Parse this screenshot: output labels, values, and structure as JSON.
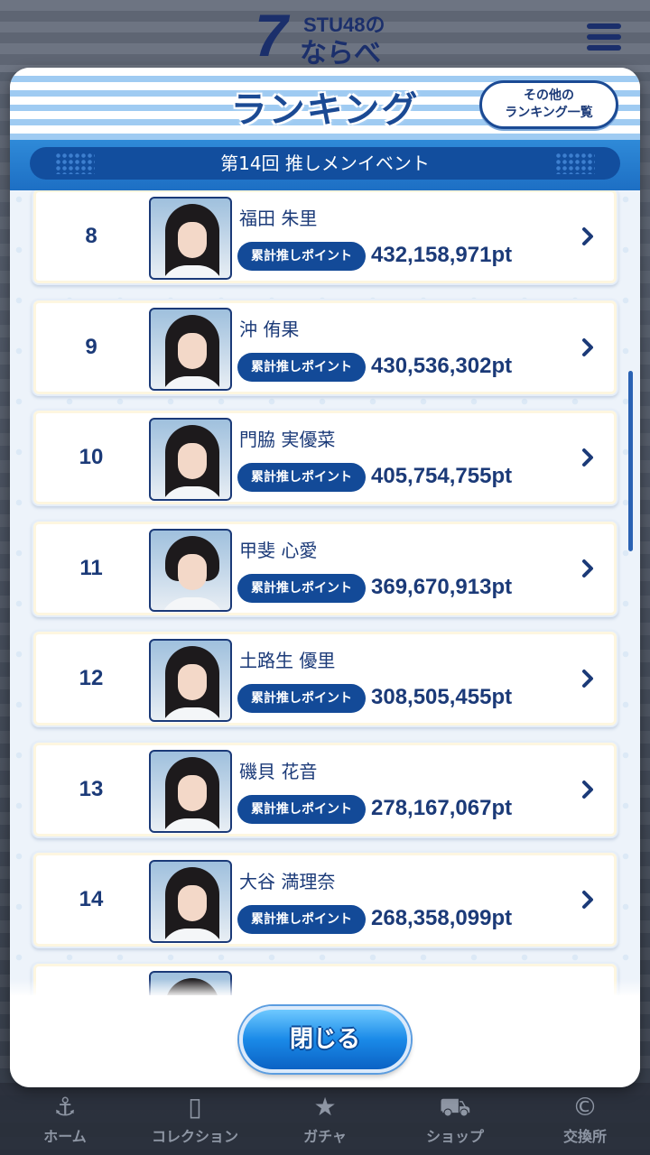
{
  "app": {
    "logo_number": "7",
    "logo_top": "STU48の",
    "logo_bottom": "ならべ"
  },
  "modal": {
    "title": "ランキング",
    "other_rankings_line1": "その他の",
    "other_rankings_line2": "ランキング一覧",
    "event_name": "第14回 推しメンイベント",
    "close_label": "閉じる"
  },
  "rankings": [
    {
      "rank": "8",
      "name": "福田 朱里",
      "badge": "累計推しポイント",
      "points": "432,158,971pt"
    },
    {
      "rank": "9",
      "name": "沖 侑果",
      "badge": "累計推しポイント",
      "points": "430,536,302pt"
    },
    {
      "rank": "10",
      "name": "門脇 実優菜",
      "badge": "累計推しポイント",
      "points": "405,754,755pt"
    },
    {
      "rank": "11",
      "name": "甲斐 心愛",
      "badge": "累計推しポイント",
      "points": "369,670,913pt"
    },
    {
      "rank": "12",
      "name": "土路生 優里",
      "badge": "累計推しポイント",
      "points": "308,505,455pt"
    },
    {
      "rank": "13",
      "name": "磯貝 花音",
      "badge": "累計推しポイント",
      "points": "278,167,067pt"
    },
    {
      "rank": "14",
      "name": "大谷 満理奈",
      "badge": "累計推しポイント",
      "points": "268,358,099pt"
    }
  ],
  "bottom_nav": [
    {
      "label": "ホーム",
      "icon": "anchor-icon"
    },
    {
      "label": "コレクション",
      "icon": "collection-icon"
    },
    {
      "label": "ガチャ",
      "icon": "gacha-icon"
    },
    {
      "label": "ショップ",
      "icon": "cart-icon"
    },
    {
      "label": "交換所",
      "icon": "exchange-icon"
    }
  ],
  "colors": {
    "navy": "#1b3a78",
    "badge": "#134a98",
    "accent": "#1d6fc4"
  }
}
